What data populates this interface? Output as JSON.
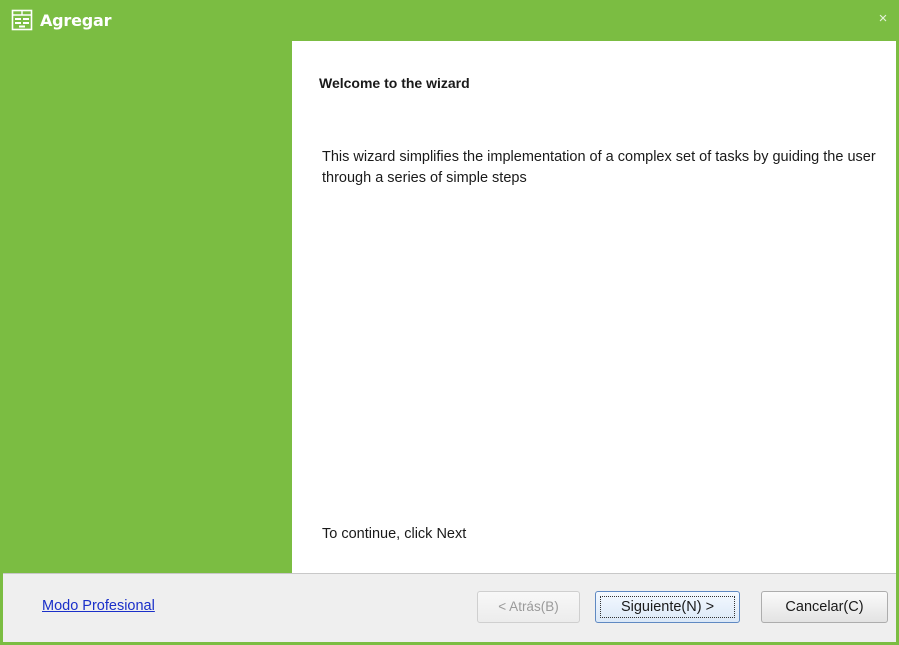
{
  "window": {
    "title": "Agregar",
    "close_glyph": "×",
    "title_icon": "wizard-app-icon",
    "accent_color": "#7bbd42"
  },
  "content": {
    "heading": "Welcome to the wizard",
    "description": "This wizard simplifies the implementation of a complex set of tasks by guiding the user through a series of simple steps",
    "continue_text": "To continue, click Next"
  },
  "footer": {
    "pro_mode_link": "Modo Profesional",
    "back_label": "< Atrás(B)",
    "next_label": "Siguiente(N) >",
    "cancel_label": "Cancelar(C)"
  }
}
